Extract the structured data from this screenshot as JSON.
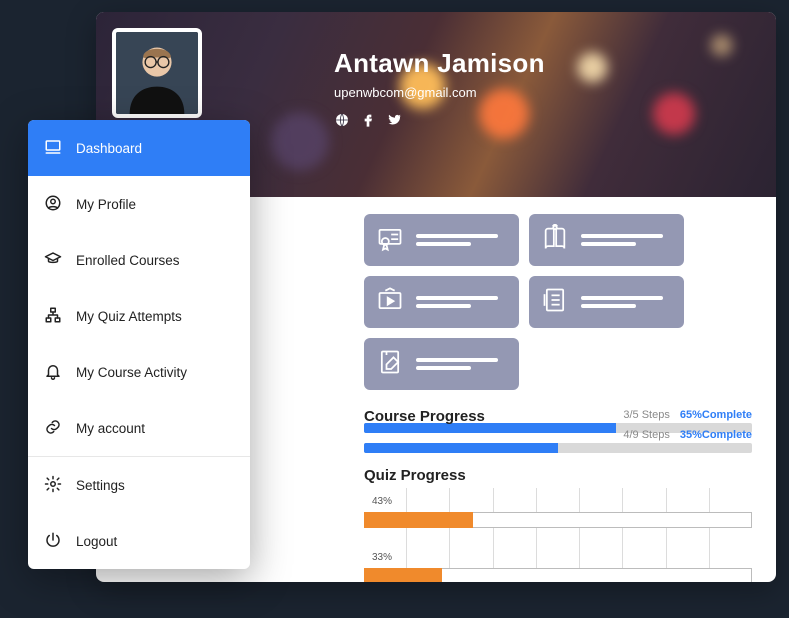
{
  "user": {
    "name": "Antawn Jamison",
    "email": "upenwbcom@gmail.com"
  },
  "sidebar": {
    "items": [
      {
        "label": "Dashboard",
        "icon": "monitor-icon",
        "active": true
      },
      {
        "label": "My Profile",
        "icon": "user-circle-icon"
      },
      {
        "label": "Enrolled Courses",
        "icon": "graduation-cap-icon"
      },
      {
        "label": "My Quiz Attempts",
        "icon": "sitemap-icon"
      },
      {
        "label": "My Course Activity",
        "icon": "bell-icon"
      },
      {
        "label": "My account",
        "icon": "link-icon"
      },
      {
        "label": "Settings",
        "icon": "gear-icon",
        "sepBefore": true
      },
      {
        "label": "Logout",
        "icon": "power-icon"
      }
    ]
  },
  "tiles": [
    {
      "icon": "certificate-icon"
    },
    {
      "icon": "book-idea-icon"
    },
    {
      "icon": "video-play-icon"
    },
    {
      "icon": "checklist-icon"
    },
    {
      "icon": "note-edit-icon"
    }
  ],
  "course_progress": {
    "heading": "Course Progress",
    "rows": [
      {
        "steps": "3/5 Steps",
        "pct": "65%",
        "pct_suffix": "Complete",
        "width": 65
      },
      {
        "steps": "4/9 Steps",
        "pct": "35%",
        "pct_suffix": "Complete",
        "width": 50
      }
    ]
  },
  "quiz_progress": {
    "heading": "Quiz Progress",
    "bars": [
      {
        "label": "43%",
        "width": 28
      },
      {
        "label": "33%",
        "width": 20
      }
    ]
  }
}
